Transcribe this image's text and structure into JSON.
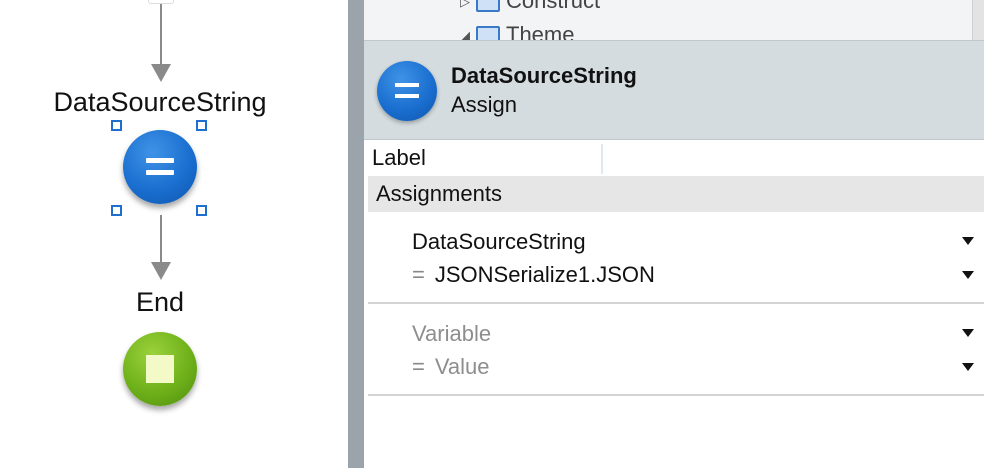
{
  "flow": {
    "assign_node_label": "DataSourceString",
    "end_node_label": "End"
  },
  "tree": {
    "items": [
      {
        "label": "Construct"
      },
      {
        "label": "Theme"
      }
    ]
  },
  "properties": {
    "element_name": "DataSourceString",
    "element_type": "Assign",
    "label_field": {
      "label": "Label",
      "value": ""
    },
    "assignments_header": "Assignments",
    "assignments": [
      {
        "variable": "DataSourceString",
        "value": "JSONSerialize1.JSON",
        "equals": "="
      }
    ],
    "new_assignment": {
      "variable_placeholder": "Variable",
      "value_placeholder": "Value",
      "equals": "="
    }
  },
  "colors": {
    "assign_blue": "#1a6fd0",
    "end_green": "#6fb11a",
    "header_bg": "#d4dcdf",
    "splitter": "#9aa4aa",
    "selection": "#1e6fd0"
  }
}
